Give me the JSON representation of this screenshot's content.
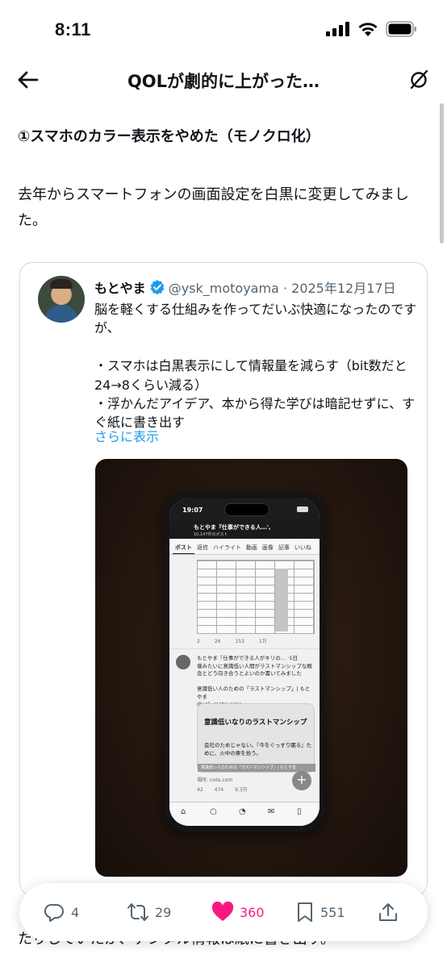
{
  "status_bar": {
    "time": "8:11"
  },
  "header": {
    "title": "QOLが劇的に上がった…"
  },
  "article": {
    "heading": "①スマホのカラー表示をやめた（モノクロ化）",
    "paragraph": "去年からスマートフォンの画面設定を白黒に変更してみました。",
    "cut_off_text": "たりしていたが、デジタル情報は紙に書き出す。"
  },
  "embedded_post": {
    "author_name": "もとやま",
    "handle": "@ysk_motoyama",
    "separator": "·",
    "date": "2025年12月17日",
    "text": "脳を軽くする仕組みを作ってだいぶ快適になったのですが、\n\n・スマホは白黒表示にして情報量を減らす（bit数だと24→8くらい減る）\n・浮かんだアイデア、本から得た学びは暗記せずに、すぐ紙に書き出す",
    "show_more": "さらに表示",
    "photo": {
      "phone_time": "19:07",
      "phone_battery": "72",
      "header_title": "もとやま『仕事ができる人…',",
      "header_sub": "10,147件のポスト",
      "tabs": [
        "ポスト",
        "返信",
        "ハイライト",
        "動画",
        "画像",
        "記事",
        "いいね"
      ],
      "metrics_1": [
        "2",
        "26",
        "153",
        "1万"
      ],
      "retweet_text": "もとやま『仕事ができる人がキリの… ·1日\n僕みたいに意識低い人間がラストマンシップな概念とどう向き合うとよいのか書いてみました\n\n意識低い人のための「ラストマンシップ」| もとやま\n@ysk_motoyama",
      "card_title": "意識低いなりのラストマンシップ",
      "card_sub": "会社のためじゃない。『今をぐっすり眠る』ために、火中の栗を拾う。",
      "card_bar": "意識低い人のための「ラストマンシップ」| もとやま",
      "source": "場所: note.com",
      "metrics_2": [
        "42",
        "474",
        "9.3万"
      ]
    }
  },
  "actions": {
    "replies": "4",
    "reposts": "29",
    "likes": "360",
    "bookmarks": "551"
  },
  "colors": {
    "text": "#0f1419",
    "secondary": "#536471",
    "link": "#1d9bf0",
    "like": "#f91880",
    "border": "#cfd9de"
  }
}
